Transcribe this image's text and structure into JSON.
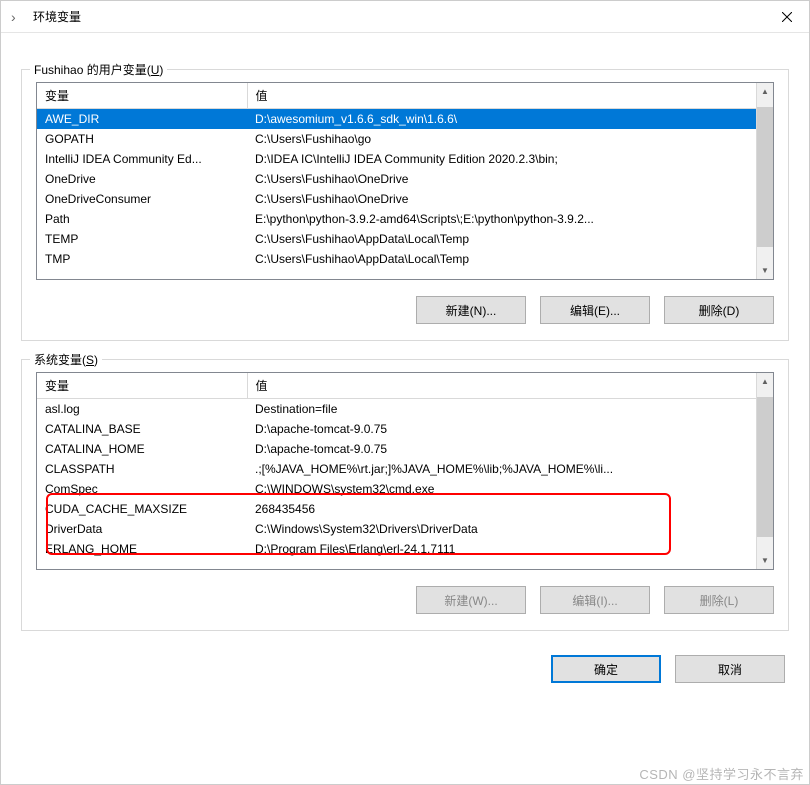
{
  "title": "环境变量",
  "user_section": {
    "label_pre": "Fushihao 的用户变量(",
    "label_key": "U",
    "label_post": ")",
    "headers": {
      "var": "变量",
      "val": "值"
    },
    "rows": [
      {
        "var": "AWE_DIR",
        "val": "D:\\awesomium_v1.6.6_sdk_win\\1.6.6\\",
        "selected": true
      },
      {
        "var": "GOPATH",
        "val": "C:\\Users\\Fushihao\\go"
      },
      {
        "var": "IntelliJ IDEA Community Ed...",
        "val": "D:\\IDEA IC\\IntelliJ IDEA Community Edition 2020.2.3\\bin;"
      },
      {
        "var": "OneDrive",
        "val": "C:\\Users\\Fushihao\\OneDrive"
      },
      {
        "var": "OneDriveConsumer",
        "val": "C:\\Users\\Fushihao\\OneDrive"
      },
      {
        "var": "Path",
        "val": "E:\\python\\python-3.9.2-amd64\\Scripts\\;E:\\python\\python-3.9.2..."
      },
      {
        "var": "TEMP",
        "val": "C:\\Users\\Fushihao\\AppData\\Local\\Temp"
      },
      {
        "var": "TMP",
        "val": "C:\\Users\\Fushihao\\AppData\\Local\\Temp"
      }
    ],
    "buttons": {
      "new": "新建(N)...",
      "edit": "编辑(E)...",
      "delete": "删除(D)"
    }
  },
  "sys_section": {
    "label_pre": "系统变量(",
    "label_key": "S",
    "label_post": ")",
    "headers": {
      "var": "变量",
      "val": "值"
    },
    "rows": [
      {
        "var": "asl.log",
        "val": "Destination=file"
      },
      {
        "var": "CATALINA_BASE",
        "val": "D:\\apache-tomcat-9.0.75"
      },
      {
        "var": "CATALINA_HOME",
        "val": "D:\\apache-tomcat-9.0.75"
      },
      {
        "var": "CLASSPATH",
        "val": ".;[%JAVA_HOME%\\rt.jar;]%JAVA_HOME%\\lib;%JAVA_HOME%\\li..."
      },
      {
        "var": "ComSpec",
        "val": "C:\\WINDOWS\\system32\\cmd.exe"
      },
      {
        "var": "CUDA_CACHE_MAXSIZE",
        "val": "268435456"
      },
      {
        "var": "DriverData",
        "val": "C:\\Windows\\System32\\Drivers\\DriverData"
      },
      {
        "var": "ERLANG_HOME",
        "val": "D:\\Program Files\\Erlang\\erl-24.1.7111"
      }
    ],
    "buttons": {
      "new": "新建(W)...",
      "edit": "编辑(I)...",
      "delete": "删除(L)"
    }
  },
  "footer": {
    "ok": "确定",
    "cancel": "取消"
  },
  "watermark": "CSDN @坚持学习永不言弃"
}
